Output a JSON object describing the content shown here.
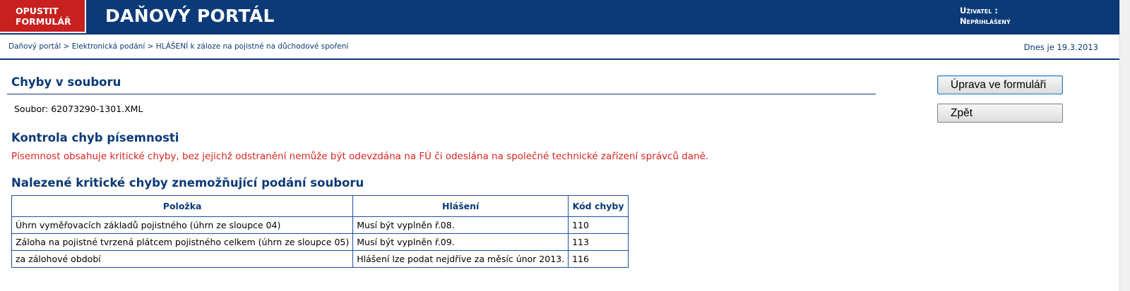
{
  "header": {
    "exit_line1": "OPUSTIT",
    "exit_line2": "FORMULÁŘ",
    "title": "DAŇOVÝ PORTÁL",
    "user_label": "Uživatel :",
    "user_value": "Nepřihlášený"
  },
  "breadcrumb": {
    "items": [
      "Daňový portál",
      "Elektronická podání",
      "HLÁŠENÍ k záloze na pojistné na důchodové spoření"
    ],
    "separator": ">"
  },
  "date": "Dnes je 19.3.2013",
  "section_errors": {
    "title": "Chyby v souboru",
    "file_label": "Soubor:",
    "file_name": "62073290-1301.XML"
  },
  "check": {
    "title": "Kontrola chyb písemnosti",
    "message": "Písemnost obsahuje kritické chyby, bez jejichž odstranění nemůže být odevzdána na FÚ či odeslána na společné technické zařízení správců daně."
  },
  "found": {
    "title": "Nalezené kritické chyby znemožňující podání souboru",
    "columns": [
      "Položka",
      "Hlášení",
      "Kód chyby"
    ],
    "rows": [
      [
        "Úhrn vyměřovacích základů pojistného (úhrn ze sloupce 04)",
        "Musí být vyplněn ř.08.",
        "110"
      ],
      [
        "Záloha na pojistné tvrzená plátcem pojistného celkem (úhrn ze sloupce 05)",
        "Musí být vyplněn ř.09.",
        "113"
      ],
      [
        "za zálohové období",
        "Hlášení lze podat nejdříve za měsíc únor 2013.",
        "116"
      ]
    ]
  },
  "actions": {
    "edit_label": "Úprava ve formuláři",
    "back_label": "Zpět"
  },
  "colors": {
    "header_blue": "#0b3a78",
    "exit_red": "#c8201f",
    "warning_red": "#d9231f"
  }
}
